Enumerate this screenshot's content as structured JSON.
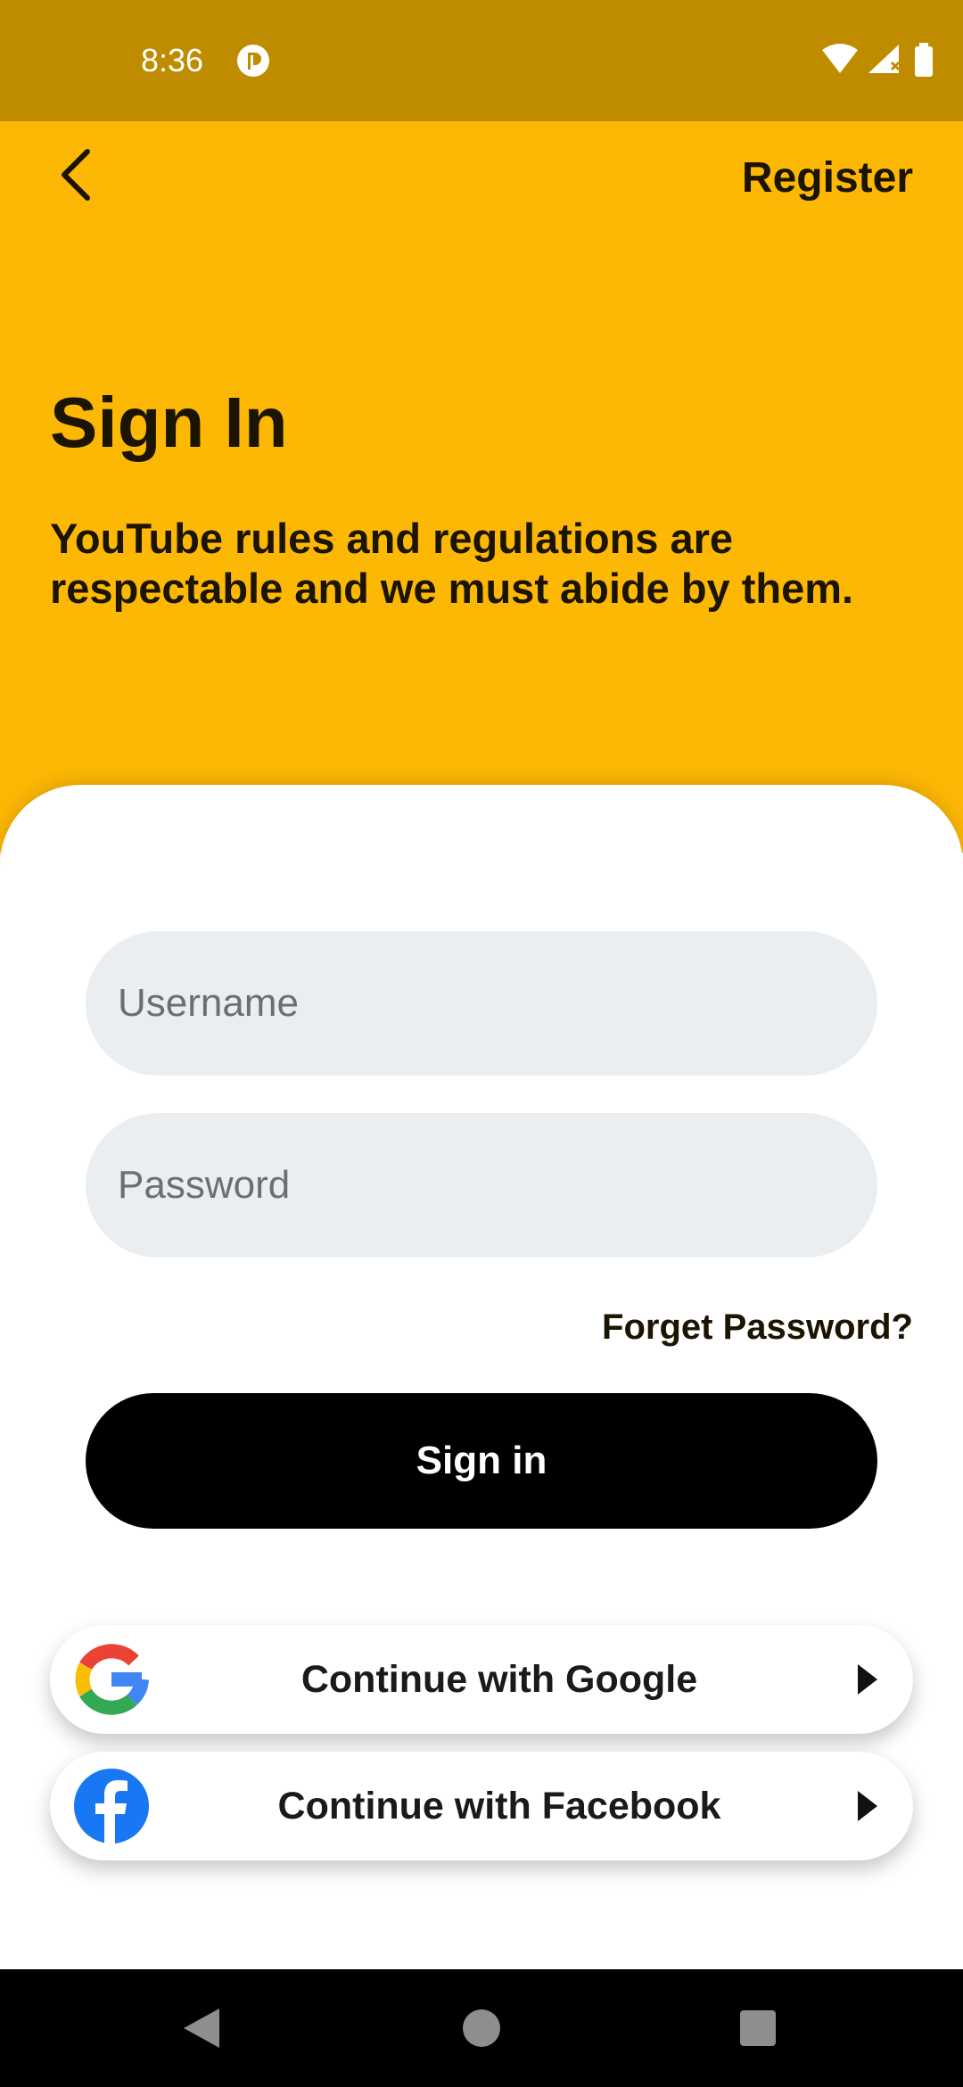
{
  "status_bar": {
    "time": "8:36",
    "icons": [
      "app-notification-icon",
      "wifi-icon",
      "signal-icon",
      "battery-icon"
    ]
  },
  "header": {
    "back_icon": "chevron-left-icon",
    "register_label": "Register",
    "title": "Sign In",
    "subtitle": "YouTube rules and regulations are respectable and we must abide by them.",
    "background_color": "#FDB805"
  },
  "form": {
    "username_placeholder": "Username",
    "password_placeholder": "Password",
    "forgot_label": "Forget Password?",
    "signin_label": "Sign in"
  },
  "social": {
    "google_label": "Continue with Google",
    "facebook_label": "Continue with Facebook",
    "google_icon": "google-logo-icon",
    "facebook_icon": "facebook-logo-icon",
    "facebook_color": "#1877F2"
  },
  "nav_bar": {
    "icons": [
      "nav-back-icon",
      "nav-home-icon",
      "nav-recent-icon"
    ]
  }
}
